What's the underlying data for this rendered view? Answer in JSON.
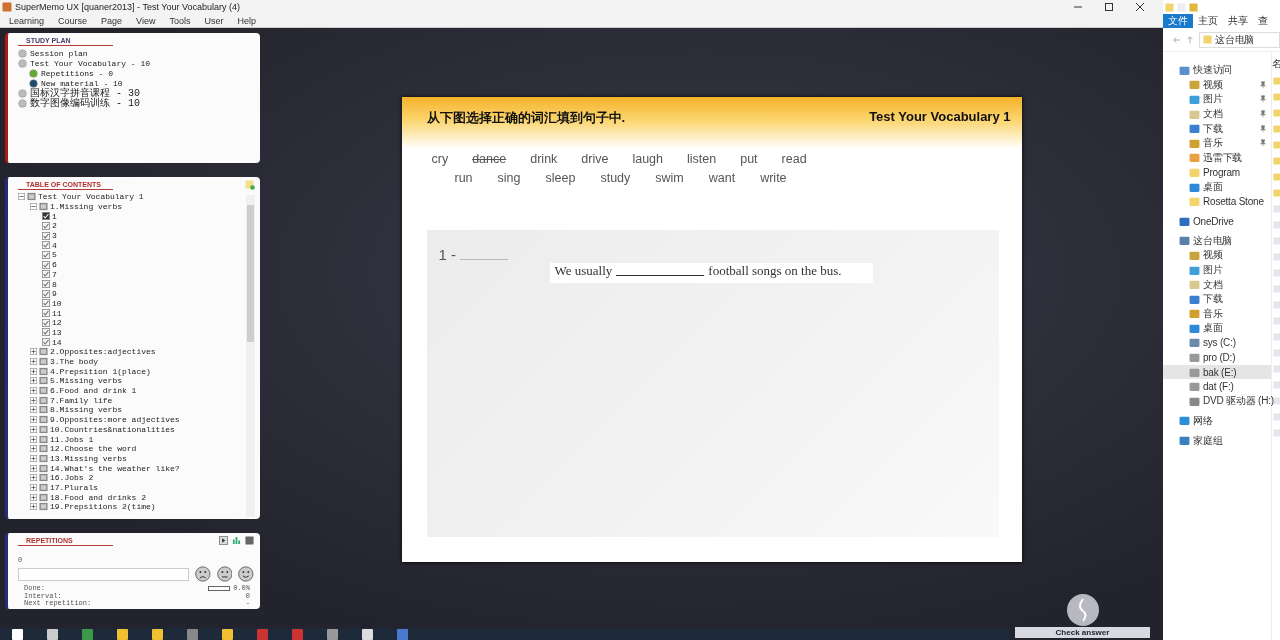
{
  "window": {
    "title": "SuperMemo UX [quaner2013] - Test Your Vocabulary (4)"
  },
  "menu": [
    "Learning",
    "Course",
    "Page",
    "View",
    "Tools",
    "User",
    "Help"
  ],
  "study_plan": {
    "title": "STUDY PLAN",
    "items": [
      {
        "label": "Session plan",
        "kind": "plan"
      },
      {
        "label": "Test Your Vocabulary - 10",
        "kind": "plan",
        "children": [
          {
            "label": "Repetitions - 0",
            "kind": "repetitions"
          },
          {
            "label": "New material - 10",
            "kind": "new"
          }
        ]
      },
      {
        "label": "国标汉字拼音课程 - 30",
        "kind": "plan"
      },
      {
        "label": "数字图像编码训练 - 10",
        "kind": "plan"
      }
    ]
  },
  "contents": {
    "title": "TABLE OF CONTENTS",
    "tree": [
      {
        "label": "Test Your Vocabulary 1",
        "kind": "lesson",
        "expanded": true,
        "children": [
          {
            "label": "1.Missing verbs",
            "kind": "lesson",
            "expanded": true,
            "children": [
              {
                "label": "1",
                "kind": "item",
                "checked": true,
                "selected": true
              },
              {
                "label": "2",
                "kind": "item",
                "checked": true,
                "selected": false
              },
              {
                "label": "3",
                "kind": "item",
                "checked": true,
                "selected": false
              },
              {
                "label": "4",
                "kind": "item",
                "checked": true,
                "selected": false
              },
              {
                "label": "5",
                "kind": "item",
                "checked": true,
                "selected": false
              },
              {
                "label": "6",
                "kind": "item",
                "checked": true,
                "selected": false
              },
              {
                "label": "7",
                "kind": "item",
                "checked": true,
                "selected": false
              },
              {
                "label": "8",
                "kind": "item",
                "checked": true,
                "selected": false
              },
              {
                "label": "9",
                "kind": "item",
                "checked": true,
                "selected": false
              },
              {
                "label": "10",
                "kind": "item",
                "checked": true,
                "selected": false
              },
              {
                "label": "11",
                "kind": "item",
                "checked": true,
                "selected": false
              },
              {
                "label": "12",
                "kind": "item",
                "checked": true,
                "selected": false
              },
              {
                "label": "13",
                "kind": "item",
                "checked": true,
                "selected": false
              },
              {
                "label": "14",
                "kind": "item",
                "checked": true,
                "selected": false
              }
            ]
          },
          {
            "label": "2.Opposites:adjectives",
            "kind": "lesson",
            "expanded": false
          },
          {
            "label": "3.The body",
            "kind": "lesson",
            "expanded": false
          },
          {
            "label": "4.Prepsition 1(place)",
            "kind": "lesson",
            "expanded": false
          },
          {
            "label": "5.Missing verbs",
            "kind": "lesson",
            "expanded": false
          },
          {
            "label": "6.Food and drink 1",
            "kind": "lesson",
            "expanded": false
          },
          {
            "label": "7.Family life",
            "kind": "lesson",
            "expanded": false
          },
          {
            "label": "8.Missing verbs",
            "kind": "lesson",
            "expanded": false
          },
          {
            "label": "9.Opposites:more adjectives",
            "kind": "lesson",
            "expanded": false
          },
          {
            "label": "10.Countries&nationalities",
            "kind": "lesson",
            "expanded": false
          },
          {
            "label": "11.Jobs 1",
            "kind": "lesson",
            "expanded": false
          },
          {
            "label": "12.Choose the word",
            "kind": "lesson",
            "expanded": false
          },
          {
            "label": "13.Missing verbs",
            "kind": "lesson",
            "expanded": false
          },
          {
            "label": "14.What's the weather like?",
            "kind": "lesson",
            "expanded": false
          },
          {
            "label": "16.Jobs 2",
            "kind": "lesson",
            "expanded": false
          },
          {
            "label": "17.Plurals",
            "kind": "lesson",
            "expanded": false
          },
          {
            "label": "18.Food and drinks 2",
            "kind": "lesson",
            "expanded": false
          },
          {
            "label": "19.Prepsitions 2(time)",
            "kind": "lesson",
            "expanded": false
          }
        ]
      }
    ]
  },
  "repetitions": {
    "title": "REPETITIONS",
    "count": "0",
    "stats": [
      {
        "label": "Done:",
        "value": "0.0%",
        "kind": "progress",
        "level": 0
      },
      {
        "label": "Interval:",
        "value": "0",
        "kind": "text"
      },
      {
        "label": "Next repetition:",
        "value": "-",
        "kind": "text"
      }
    ]
  },
  "card": {
    "instruction": "从下图选择正确的词汇填到句子中.",
    "title": "Test Your Vocabulary 1",
    "word_rows": [
      [
        {
          "word": "cry",
          "used": false
        },
        {
          "word": "dance",
          "used": true
        },
        {
          "word": "drink",
          "used": false
        },
        {
          "word": "drive",
          "used": false
        },
        {
          "word": "laugh",
          "used": false
        },
        {
          "word": "listen",
          "used": false
        },
        {
          "word": "put",
          "used": false
        },
        {
          "word": "read",
          "used": false
        }
      ],
      [
        {
          "word": "run",
          "used": false
        },
        {
          "word": "sing",
          "used": false
        },
        {
          "word": "sleep",
          "used": false
        },
        {
          "word": "study",
          "used": false
        },
        {
          "word": "swim",
          "used": false
        },
        {
          "word": "want",
          "used": false
        },
        {
          "word": "write",
          "used": false
        }
      ]
    ],
    "question": {
      "number": "1 -",
      "before": "We usually",
      "after": "football songs on the bus."
    }
  },
  "check_answer": {
    "label": "Check answer"
  },
  "explorer": {
    "ribbon_tabs": [
      {
        "label": "文件",
        "selected": true
      },
      {
        "label": "主页",
        "selected": false
      },
      {
        "label": "共享",
        "selected": false
      },
      {
        "label": "查",
        "selected": false
      }
    ],
    "address": "这台电脑",
    "column_header": "名",
    "nav": [
      {
        "label": "快速访问",
        "kind": "quick",
        "selected": false,
        "children": [
          {
            "label": "视频",
            "kind": "video",
            "pinned": true,
            "selected": false
          },
          {
            "label": "图片",
            "kind": "pictures",
            "pinned": true,
            "selected": false
          },
          {
            "label": "文档",
            "kind": "docs",
            "pinned": true,
            "selected": false
          },
          {
            "label": "下载",
            "kind": "download",
            "pinned": true,
            "selected": false
          },
          {
            "label": "音乐",
            "kind": "music",
            "pinned": true,
            "selected": false
          },
          {
            "label": "迅雷下载",
            "kind": "app",
            "pinned": false,
            "selected": false
          },
          {
            "label": "Program",
            "kind": "folder",
            "pinned": false,
            "selected": false
          },
          {
            "label": "桌面",
            "kind": "desktop",
            "pinned": false,
            "selected": false
          },
          {
            "label": "Rosetta Stone",
            "kind": "folder",
            "pinned": false,
            "selected": false
          }
        ]
      },
      {
        "label": "OneDrive",
        "kind": "cloud",
        "selected": false
      },
      {
        "label": "这台电脑",
        "kind": "pc",
        "selected": false,
        "children": [
          {
            "label": "视频",
            "kind": "video",
            "selected": false
          },
          {
            "label": "图片",
            "kind": "pictures",
            "selected": false
          },
          {
            "label": "文档",
            "kind": "docs",
            "selected": false
          },
          {
            "label": "下载",
            "kind": "download",
            "selected": false
          },
          {
            "label": "音乐",
            "kind": "music",
            "selected": false
          },
          {
            "label": "桌面",
            "kind": "desktop",
            "selected": false
          },
          {
            "label": "sys (C:)",
            "kind": "sysdrive",
            "selected": false
          },
          {
            "label": "pro (D:)",
            "kind": "drive",
            "selected": false
          },
          {
            "label": "bak (E:)",
            "kind": "drive",
            "selected": true
          },
          {
            "label": "dat (F:)",
            "kind": "drive",
            "selected": false
          },
          {
            "label": "DVD 驱动器 (H:)",
            "kind": "dvd",
            "selected": false
          }
        ]
      },
      {
        "label": "网络",
        "kind": "network",
        "selected": false
      },
      {
        "label": "家庭组",
        "kind": "homegroup",
        "selected": false
      }
    ]
  }
}
